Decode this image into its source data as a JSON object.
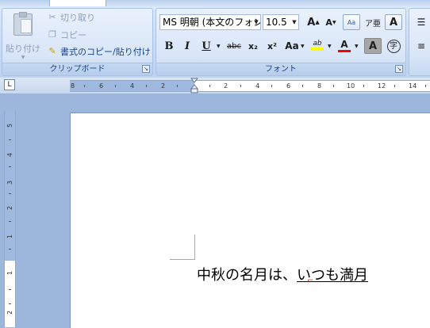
{
  "ribbon": {
    "clipboard": {
      "group_label": "クリップボード",
      "paste_label": "貼り付け",
      "cut_label": "切り取り",
      "copy_label": "コピー",
      "format_painter_label": "書式のコピー/貼り付け"
    },
    "font": {
      "group_label": "フォント",
      "font_name": "MS 明朝 (本文のフォン",
      "font_size": "10.5",
      "grow_font": "A",
      "shrink_font": "A",
      "clear_format": "Aa",
      "phonetic": "ア亜",
      "char_border": "A",
      "bold": "B",
      "italic": "I",
      "underline": "U",
      "strikethrough": "abc",
      "subscript": "x₂",
      "superscript": "x²",
      "change_case": "Aa",
      "highlight": "ab",
      "font_color": "A",
      "char_shading": "A",
      "enclose_char": "字"
    }
  },
  "ruler": {
    "tab_selector": "L",
    "h_numbers": [
      "8",
      "6",
      "4",
      "2",
      "2",
      "4",
      "6",
      "8",
      "10",
      "12",
      "14"
    ],
    "v_numbers": [
      "5",
      "4",
      "3",
      "2",
      "1",
      "1",
      "2"
    ]
  },
  "document": {
    "text_before": "中秋の名月は、",
    "text_underlined": "いつも満月"
  },
  "colors": {
    "highlight": "#ffff00",
    "font_color": "#ff0000",
    "ribbon_text": "#15428b"
  }
}
